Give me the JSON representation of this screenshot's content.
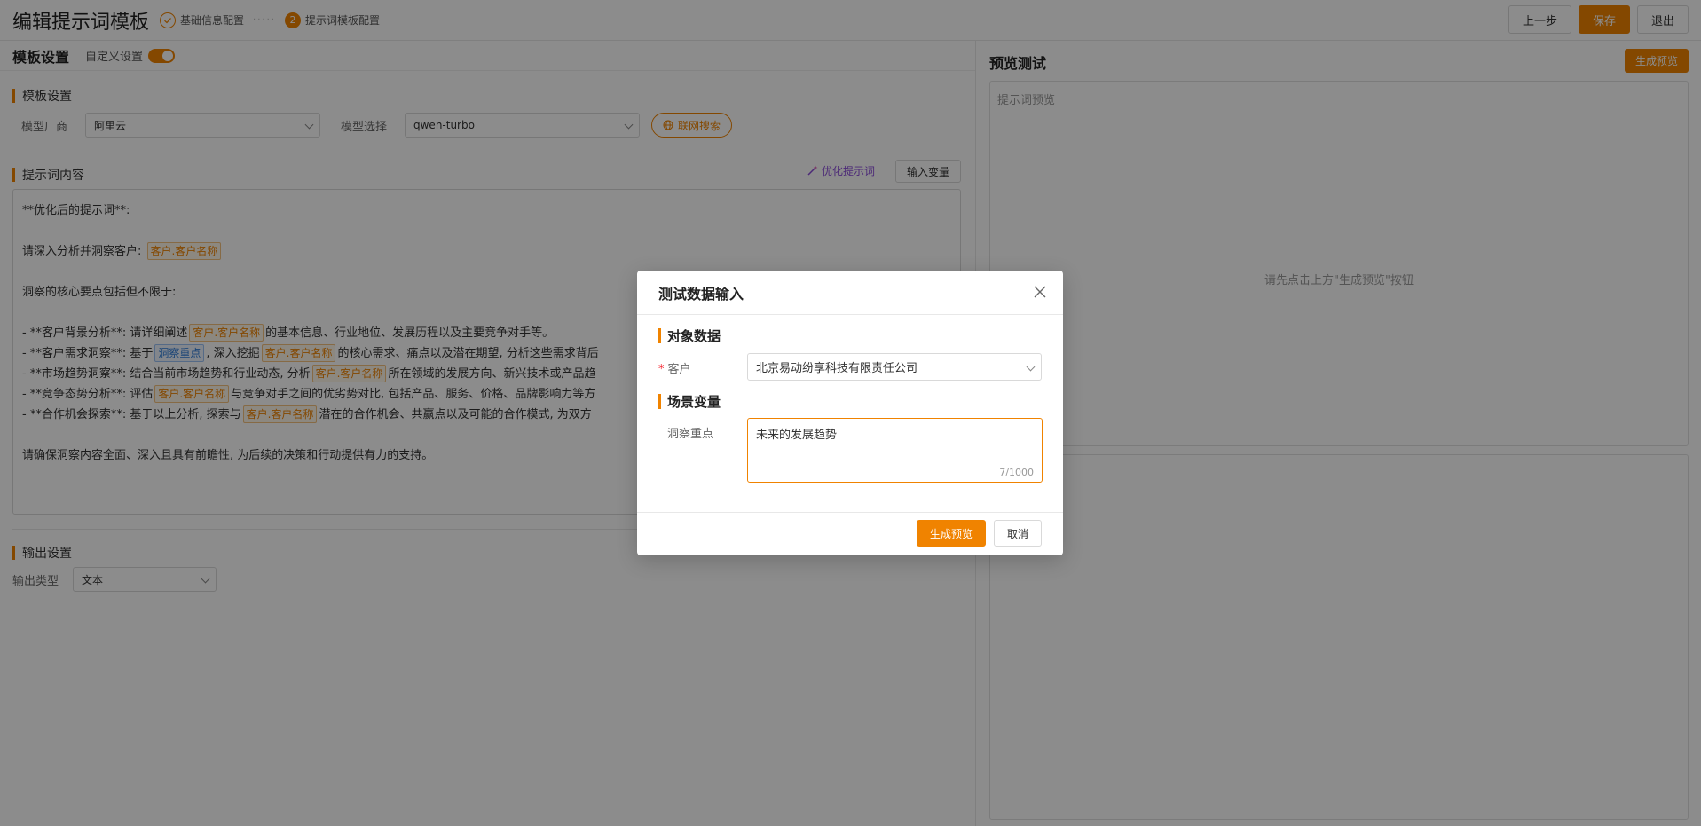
{
  "header": {
    "title": "编辑提示词模板",
    "steps": [
      {
        "index": "",
        "label": "基础信息配置"
      },
      {
        "index": "2",
        "label": "提示词模板配置"
      }
    ],
    "buttons": {
      "prev": "上一步",
      "save": "保存",
      "exit": "退出"
    }
  },
  "left": {
    "panel_title": "模板设置",
    "custom_toggle_label": "自定义设置",
    "template_section": "模板设置",
    "model_vendor_label": "模型厂商",
    "model_vendor_value": "阿里云",
    "model_select_label": "模型选择",
    "model_select_value": "qwen-turbo",
    "web_search_label": "联网搜索",
    "prompt_section": "提示词内容",
    "optimize_label": "优化提示词",
    "input_var_label": "输入变量",
    "prompt": {
      "line1": "**优化后的提示词**:",
      "line2_pre": "请深入分析并洞察客户:",
      "tag_customer": "客户.客户名称",
      "tag_focus": "洞察重点",
      "line3": "洞察的核心要点包括但不限于:",
      "b1_pre": "- **客户背景分析**:  请详细阐述",
      "b1_post": "的基本信息、行业地位、发展历程以及主要竞争对手等。",
      "b2_pre": "- **客户需求洞察**:  基于",
      "b2_mid": ", 深入挖掘",
      "b2_post": "的核心需求、痛点以及潜在期望, 分析这些需求背后",
      "b3_pre": "- **市场趋势洞察**:  结合当前市场趋势和行业动态, 分析",
      "b3_post": "所在领域的发展方向、新兴技术或产品趋",
      "b4_pre": "- **竞争态势分析**:  评估",
      "b4_post": "与竞争对手之间的优劣势对比, 包括产品、服务、价格、品牌影响力等方",
      "b5_pre": "- **合作机会探索**:  基于以上分析, 探索与",
      "b5_post": "潜在的合作机会、共赢点以及可能的合作模式, 为双方",
      "closing": "请确保洞察内容全面、深入且具有前瞻性, 为后续的决策和行动提供有力的支持。"
    },
    "output_section": "输出设置",
    "output_type_label": "输出类型",
    "output_type_value": "文本"
  },
  "right": {
    "title": "预览测试",
    "generate_label": "生成预览",
    "preview_label": "提示词预览",
    "empty_hint": "请先点击上方\"生成预览\"按钮"
  },
  "modal": {
    "title": "测试数据输入",
    "object_section": "对象数据",
    "customer_label": "客户",
    "customer_value": "北京易动纷享科技有限责任公司",
    "scene_section": "场景变量",
    "focus_label": "洞察重点",
    "focus_value": "未来的发展趋势",
    "char_count": "7/1000",
    "generate_button": "生成预览",
    "cancel_button": "取消"
  }
}
